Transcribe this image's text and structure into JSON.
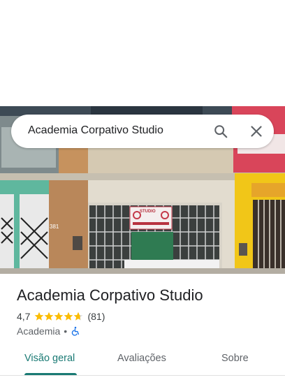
{
  "search": {
    "query": "Academia Corpativo Studio"
  },
  "photo": {
    "sign_text": "STUDIO",
    "house_number": "381"
  },
  "place": {
    "title": "Academia Corpativo Studio",
    "rating": "4,7",
    "rating_stars": 4.7,
    "review_count": "(81)",
    "category": "Academia",
    "separator": "•"
  },
  "tabs": [
    {
      "label": "Visão geral",
      "active": true
    },
    {
      "label": "Avaliações",
      "active": false
    },
    {
      "label": "Sobre",
      "active": false
    }
  ],
  "colors": {
    "accent": "#1a7a74",
    "star": "#fbbc04",
    "a11y": "#1a73e8"
  },
  "icons": {
    "search": "search-icon",
    "close": "close-icon",
    "accessibility": "wheelchair-icon",
    "star": "star-icon"
  }
}
